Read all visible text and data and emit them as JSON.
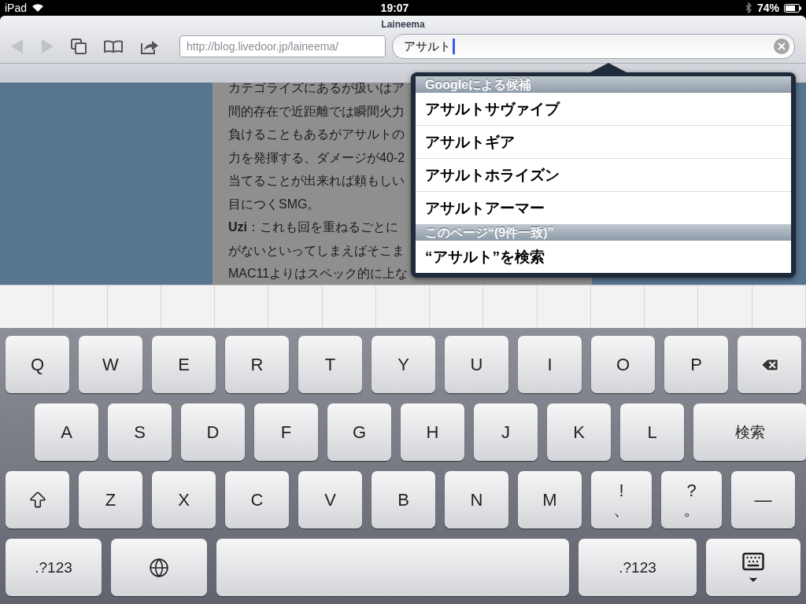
{
  "status_bar": {
    "device": "iPad",
    "time": "19:07",
    "battery": "74%"
  },
  "browser": {
    "title": "Laineema",
    "address": "http://blog.livedoor.jp/laineema/",
    "search_value": "アサルト"
  },
  "page_lines": [
    "カテゴライズにあるが扱いはア",
    "間的存在で近距離では瞬間火力",
    "負けることもあるがアサルトの",
    "力を発揮する、ダメージが40-2",
    "当てることが出来れば頼もしい",
    "目につくSMG。",
    "**Uzi**：これも回を重ねるごとに",
    "がないといってしまえばそこま",
    "MAC11よりはスペック的に上な"
  ],
  "suggestions": {
    "header": "Googleによる候補",
    "items": [
      "アサルトサヴァイブ",
      "アサルトギア",
      "アサルトホライズン",
      "アサルトアーマー"
    ],
    "page_header": "このページ“(9件一致)”",
    "search_item": "“アサルト”を検索"
  },
  "keyboard": {
    "rows": [
      {
        "keys": [
          {
            "kind": "letter",
            "label": "Q"
          },
          {
            "kind": "letter",
            "label": "W"
          },
          {
            "kind": "letter",
            "label": "E"
          },
          {
            "kind": "letter",
            "label": "R"
          },
          {
            "kind": "letter",
            "label": "T"
          },
          {
            "kind": "letter",
            "label": "Y"
          },
          {
            "kind": "letter",
            "label": "U"
          },
          {
            "kind": "letter",
            "label": "I"
          },
          {
            "kind": "letter",
            "label": "O"
          },
          {
            "kind": "letter",
            "label": "P"
          },
          {
            "kind": "backspace"
          }
        ]
      },
      {
        "keys": [
          {
            "kind": "letter",
            "label": "A"
          },
          {
            "kind": "letter",
            "label": "S"
          },
          {
            "kind": "letter",
            "label": "D"
          },
          {
            "kind": "letter",
            "label": "F"
          },
          {
            "kind": "letter",
            "label": "G"
          },
          {
            "kind": "letter",
            "label": "H"
          },
          {
            "kind": "letter",
            "label": "J"
          },
          {
            "kind": "letter",
            "label": "K"
          },
          {
            "kind": "letter",
            "label": "L"
          },
          {
            "kind": "search",
            "label": "検索"
          }
        ]
      },
      {
        "keys": [
          {
            "kind": "shift"
          },
          {
            "kind": "letter",
            "label": "Z"
          },
          {
            "kind": "letter",
            "label": "X"
          },
          {
            "kind": "letter",
            "label": "C"
          },
          {
            "kind": "letter",
            "label": "V"
          },
          {
            "kind": "letter",
            "label": "B"
          },
          {
            "kind": "letter",
            "label": "N"
          },
          {
            "kind": "letter",
            "label": "M"
          },
          {
            "kind": "dual",
            "label": "!",
            "label2": "、"
          },
          {
            "kind": "dual",
            "label": "?",
            "label2": "。"
          },
          {
            "kind": "letter",
            "label": "—"
          }
        ]
      },
      {
        "keys": [
          {
            "kind": "numbers",
            "label": ".?123"
          },
          {
            "kind": "globe"
          },
          {
            "kind": "space"
          },
          {
            "kind": "numbers2",
            "label": ".?123"
          },
          {
            "kind": "hide"
          }
        ]
      }
    ]
  }
}
